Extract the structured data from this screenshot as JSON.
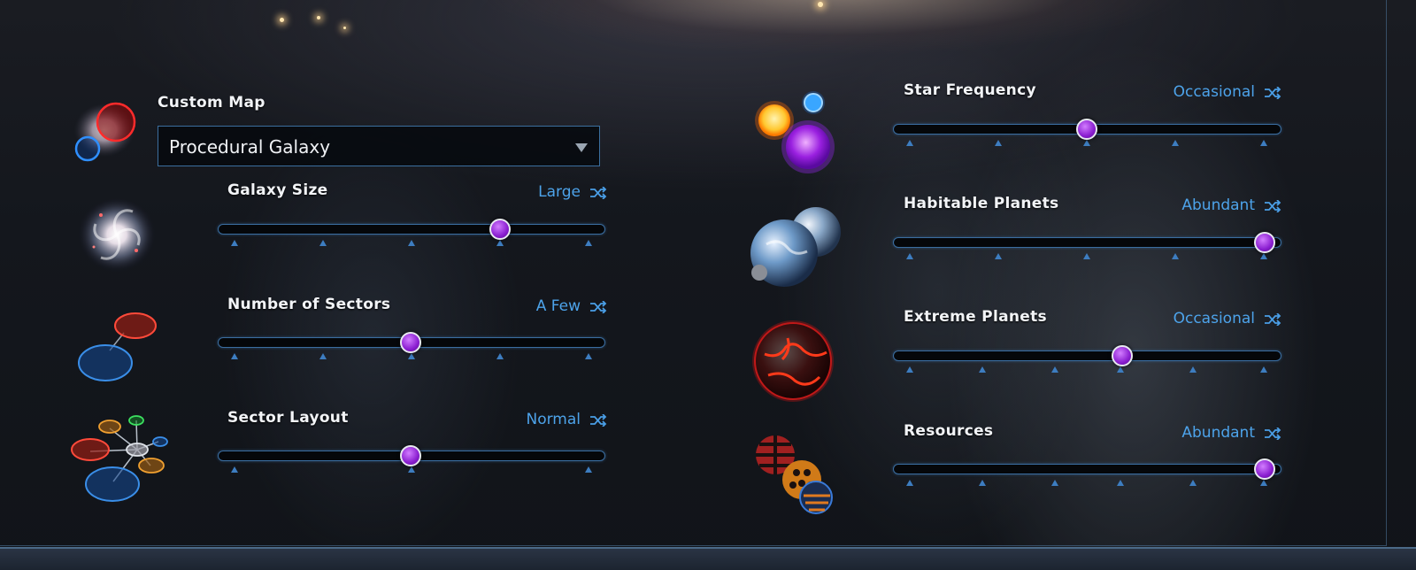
{
  "custom_map": {
    "label": "Custom Map",
    "selected": "Procedural Galaxy"
  },
  "left_settings": [
    {
      "label": "Galaxy Size",
      "value": "Large",
      "level": 0.75,
      "ticks": 5
    },
    {
      "label": "Number of Sectors",
      "value": "A Few",
      "level": 0.5,
      "ticks": 5
    },
    {
      "label": "Sector Layout",
      "value": "Normal",
      "level": 0.5,
      "ticks": 3
    }
  ],
  "right_settings": [
    {
      "label": "Star Frequency",
      "value": "Occasional",
      "level": 0.5,
      "ticks": 5
    },
    {
      "label": "Habitable Planets",
      "value": "Abundant",
      "level": 1.0,
      "ticks": 5
    },
    {
      "label": "Extreme Planets",
      "value": "Occasional",
      "level": 0.6,
      "ticks": 6
    },
    {
      "label": "Resources",
      "value": "Abundant",
      "level": 1.0,
      "ticks": 6
    }
  ],
  "icons": {
    "shuffle": "shuffle-icon",
    "custom_map": "galaxy-map-icon",
    "galaxy_size": "spiral-galaxy-icon",
    "sectors": "sector-bubbles-icon",
    "layout": "sector-network-icon",
    "stars": "stars-icon",
    "habitable": "earth-planets-icon",
    "extreme": "lava-planet-icon",
    "resources": "resources-icon"
  },
  "colors": {
    "accent_value": "#4da3ea",
    "track_border": "#3a6da0",
    "thumb": "#9b30e0"
  }
}
